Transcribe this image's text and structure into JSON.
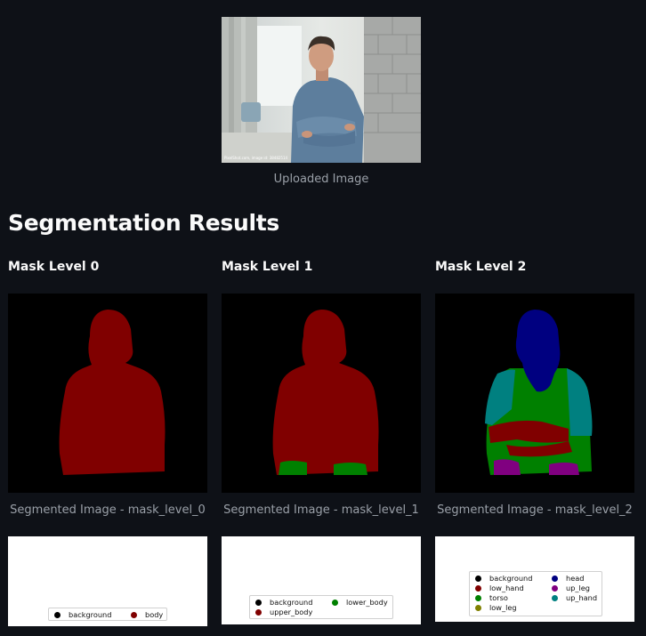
{
  "uploaded": {
    "caption": "Uploaded Image",
    "watermark": "PixelShot.com, image id: 38482514"
  },
  "section_title": "Segmentation Results",
  "columns": [
    {
      "heading": "Mask Level 0",
      "caption": "Segmented Image - mask_level_0",
      "legend": [
        {
          "label": "background",
          "color": "#000000"
        },
        {
          "label": "body",
          "color": "#800000"
        }
      ]
    },
    {
      "heading": "Mask Level 1",
      "caption": "Segmented Image - mask_level_1",
      "legend": [
        {
          "label": "background",
          "color": "#000000"
        },
        {
          "label": "lower_body",
          "color": "#008000"
        },
        {
          "label": "upper_body",
          "color": "#800000"
        }
      ]
    },
    {
      "heading": "Mask Level 2",
      "caption": "Segmented Image - mask_level_2",
      "legend": [
        {
          "label": "background",
          "color": "#000000"
        },
        {
          "label": "head",
          "color": "#000080"
        },
        {
          "label": "low_hand",
          "color": "#800000"
        },
        {
          "label": "up_leg",
          "color": "#800080"
        },
        {
          "label": "torso",
          "color": "#008000"
        },
        {
          "label": "up_hand",
          "color": "#008080"
        },
        {
          "label": "low_leg",
          "color": "#808000"
        }
      ]
    }
  ]
}
